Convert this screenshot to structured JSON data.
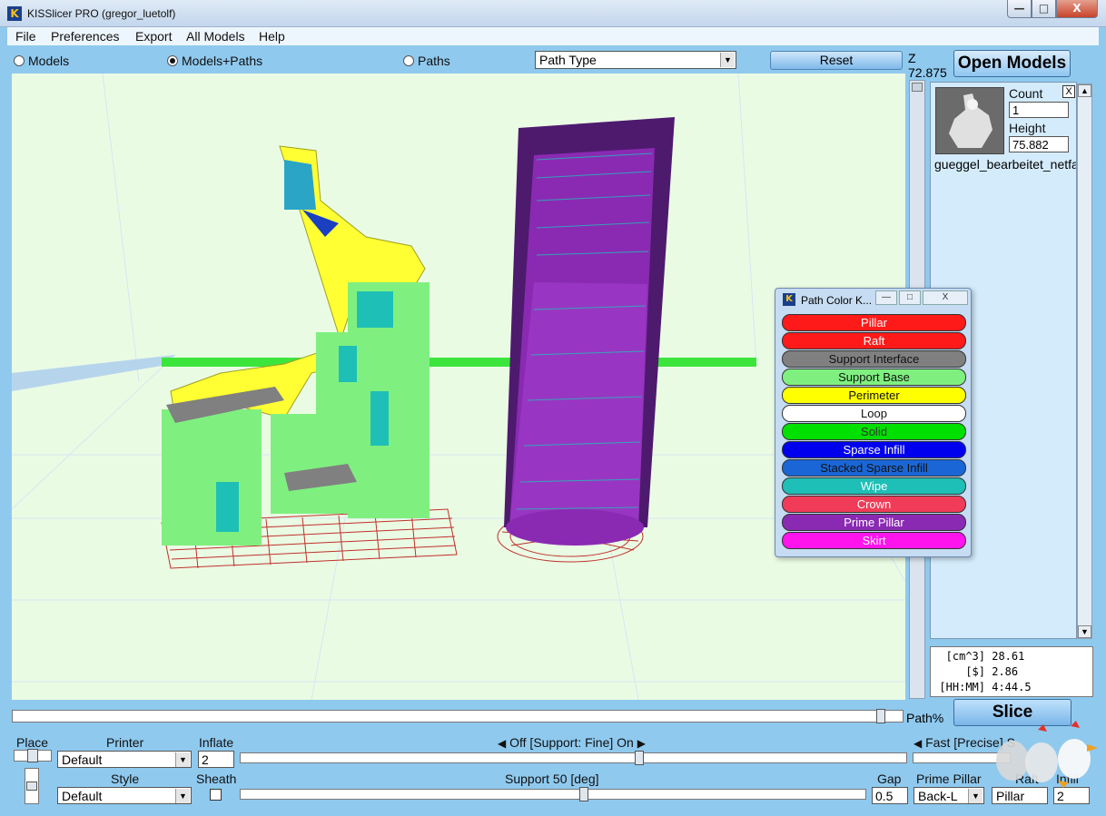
{
  "window": {
    "title": "KISSlicer PRO (gregor_luetolf)",
    "min": "—",
    "max": "□",
    "close": "X",
    "app_icon": "K"
  },
  "menu": [
    "File",
    "Preferences",
    "Export",
    "All Models",
    "Help"
  ],
  "view_modes": {
    "models": "Models",
    "models_paths": "Models+Paths",
    "paths": "Paths",
    "selected": "Models+Paths"
  },
  "path_type": {
    "value": "Path Type"
  },
  "reset_label": "Reset",
  "z": {
    "label": "Z",
    "value": "72.875"
  },
  "open_models_label": "Open Models",
  "model": {
    "count_label": "Count",
    "count_value": "1",
    "height_label": "Height",
    "height_value": "75.882",
    "name": "gueggel_bearbeitet_netfa",
    "close": "X"
  },
  "stats": [
    {
      "label": "[cm^3]",
      "value": "28.61"
    },
    {
      "label": "[$]",
      "value": "2.86"
    },
    {
      "label": "[HH:MM]",
      "value": "4:44.5"
    }
  ],
  "slice_label": "Slice",
  "path_pct": {
    "label": "Path%",
    "value": 0.98
  },
  "bottom": {
    "place_label": "Place",
    "printer_label": "Printer",
    "printer_value": "Default",
    "inflate_label": "Inflate",
    "inflate_value": "2",
    "support_label": "Off [Support: Fine] On",
    "support_value": 0.6,
    "speed_label": "Fast [Precise] Slow",
    "style_label": "Style",
    "style_value": "Default",
    "sheath_label": "Sheath",
    "support_angle_label": "Support 50 [deg]",
    "support_angle_value": 0.55,
    "gap_label": "Gap",
    "gap_value": "0.5",
    "prime_pillar_label": "Prime Pillar",
    "prime_pillar_value": "Back-L",
    "raft_label": "Raft",
    "raft_value": "Pillar",
    "infill_label": "Infill",
    "infill_value": "2"
  },
  "color_key": {
    "title": "Path Color K...",
    "items": [
      {
        "label": "Pillar",
        "color": "#ff1a1a",
        "text_color": "#ffffff"
      },
      {
        "label": "Raft",
        "color": "#ff1a1a",
        "text_color": "#ffffff"
      },
      {
        "label": "Support Interface",
        "color": "#808080",
        "text_color": "#111111"
      },
      {
        "label": "Support Base",
        "color": "#7ff07f",
        "text_color": "#111111"
      },
      {
        "label": "Perimeter",
        "color": "#ffff00",
        "text_color": "#111111"
      },
      {
        "label": "Loop",
        "color": "#ffffff",
        "text_color": "#111111"
      },
      {
        "label": "Solid",
        "color": "#00e000",
        "text_color": "#333333"
      },
      {
        "label": "Sparse Infill",
        "color": "#0000ee",
        "text_color": "#ffffff"
      },
      {
        "label": "Stacked Sparse Infill",
        "color": "#1a66d6",
        "text_color": "#111111"
      },
      {
        "label": "Wipe",
        "color": "#1ebfb6",
        "text_color": "#ffffff"
      },
      {
        "label": "Crown",
        "color": "#f03c58",
        "text_color": "#ffffff"
      },
      {
        "label": "Prime Pillar",
        "color": "#8a2ab3",
        "text_color": "#ffffff"
      },
      {
        "label": "Skirt",
        "color": "#ff14ee",
        "text_color": "#ffffff"
      }
    ]
  },
  "colors": {
    "background": "#8fc9ee",
    "viewport": "#eafbe4",
    "prime_pillar": "#8a2ab3",
    "prime_pillar_dark": "#4e1a6e"
  }
}
